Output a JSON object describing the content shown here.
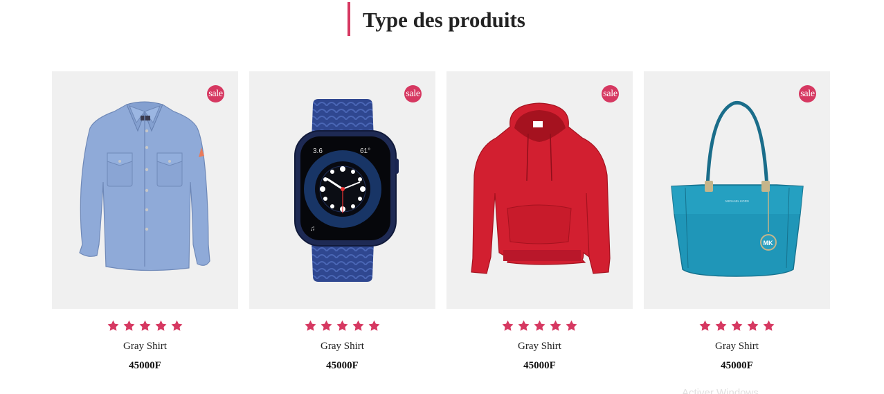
{
  "section": {
    "title": "Type des produits"
  },
  "colors": {
    "accent": "#d63861",
    "card_bg": "#f0f0f0"
  },
  "products": [
    {
      "image_icon": "blue-shirt-image",
      "badge": "sale",
      "rating": 5,
      "name": "Gray Shirt",
      "price": "45000F"
    },
    {
      "image_icon": "smartwatch-image",
      "badge": "sale",
      "rating": 5,
      "name": "Gray Shirt",
      "price": "45000F"
    },
    {
      "image_icon": "red-hoodie-image",
      "badge": "sale",
      "rating": 5,
      "name": "Gray Shirt",
      "price": "45000F"
    },
    {
      "image_icon": "teal-handbag-image",
      "badge": "sale",
      "rating": 5,
      "name": "Gray Shirt",
      "price": "45000F"
    }
  ],
  "watermark": "Activer Windows"
}
